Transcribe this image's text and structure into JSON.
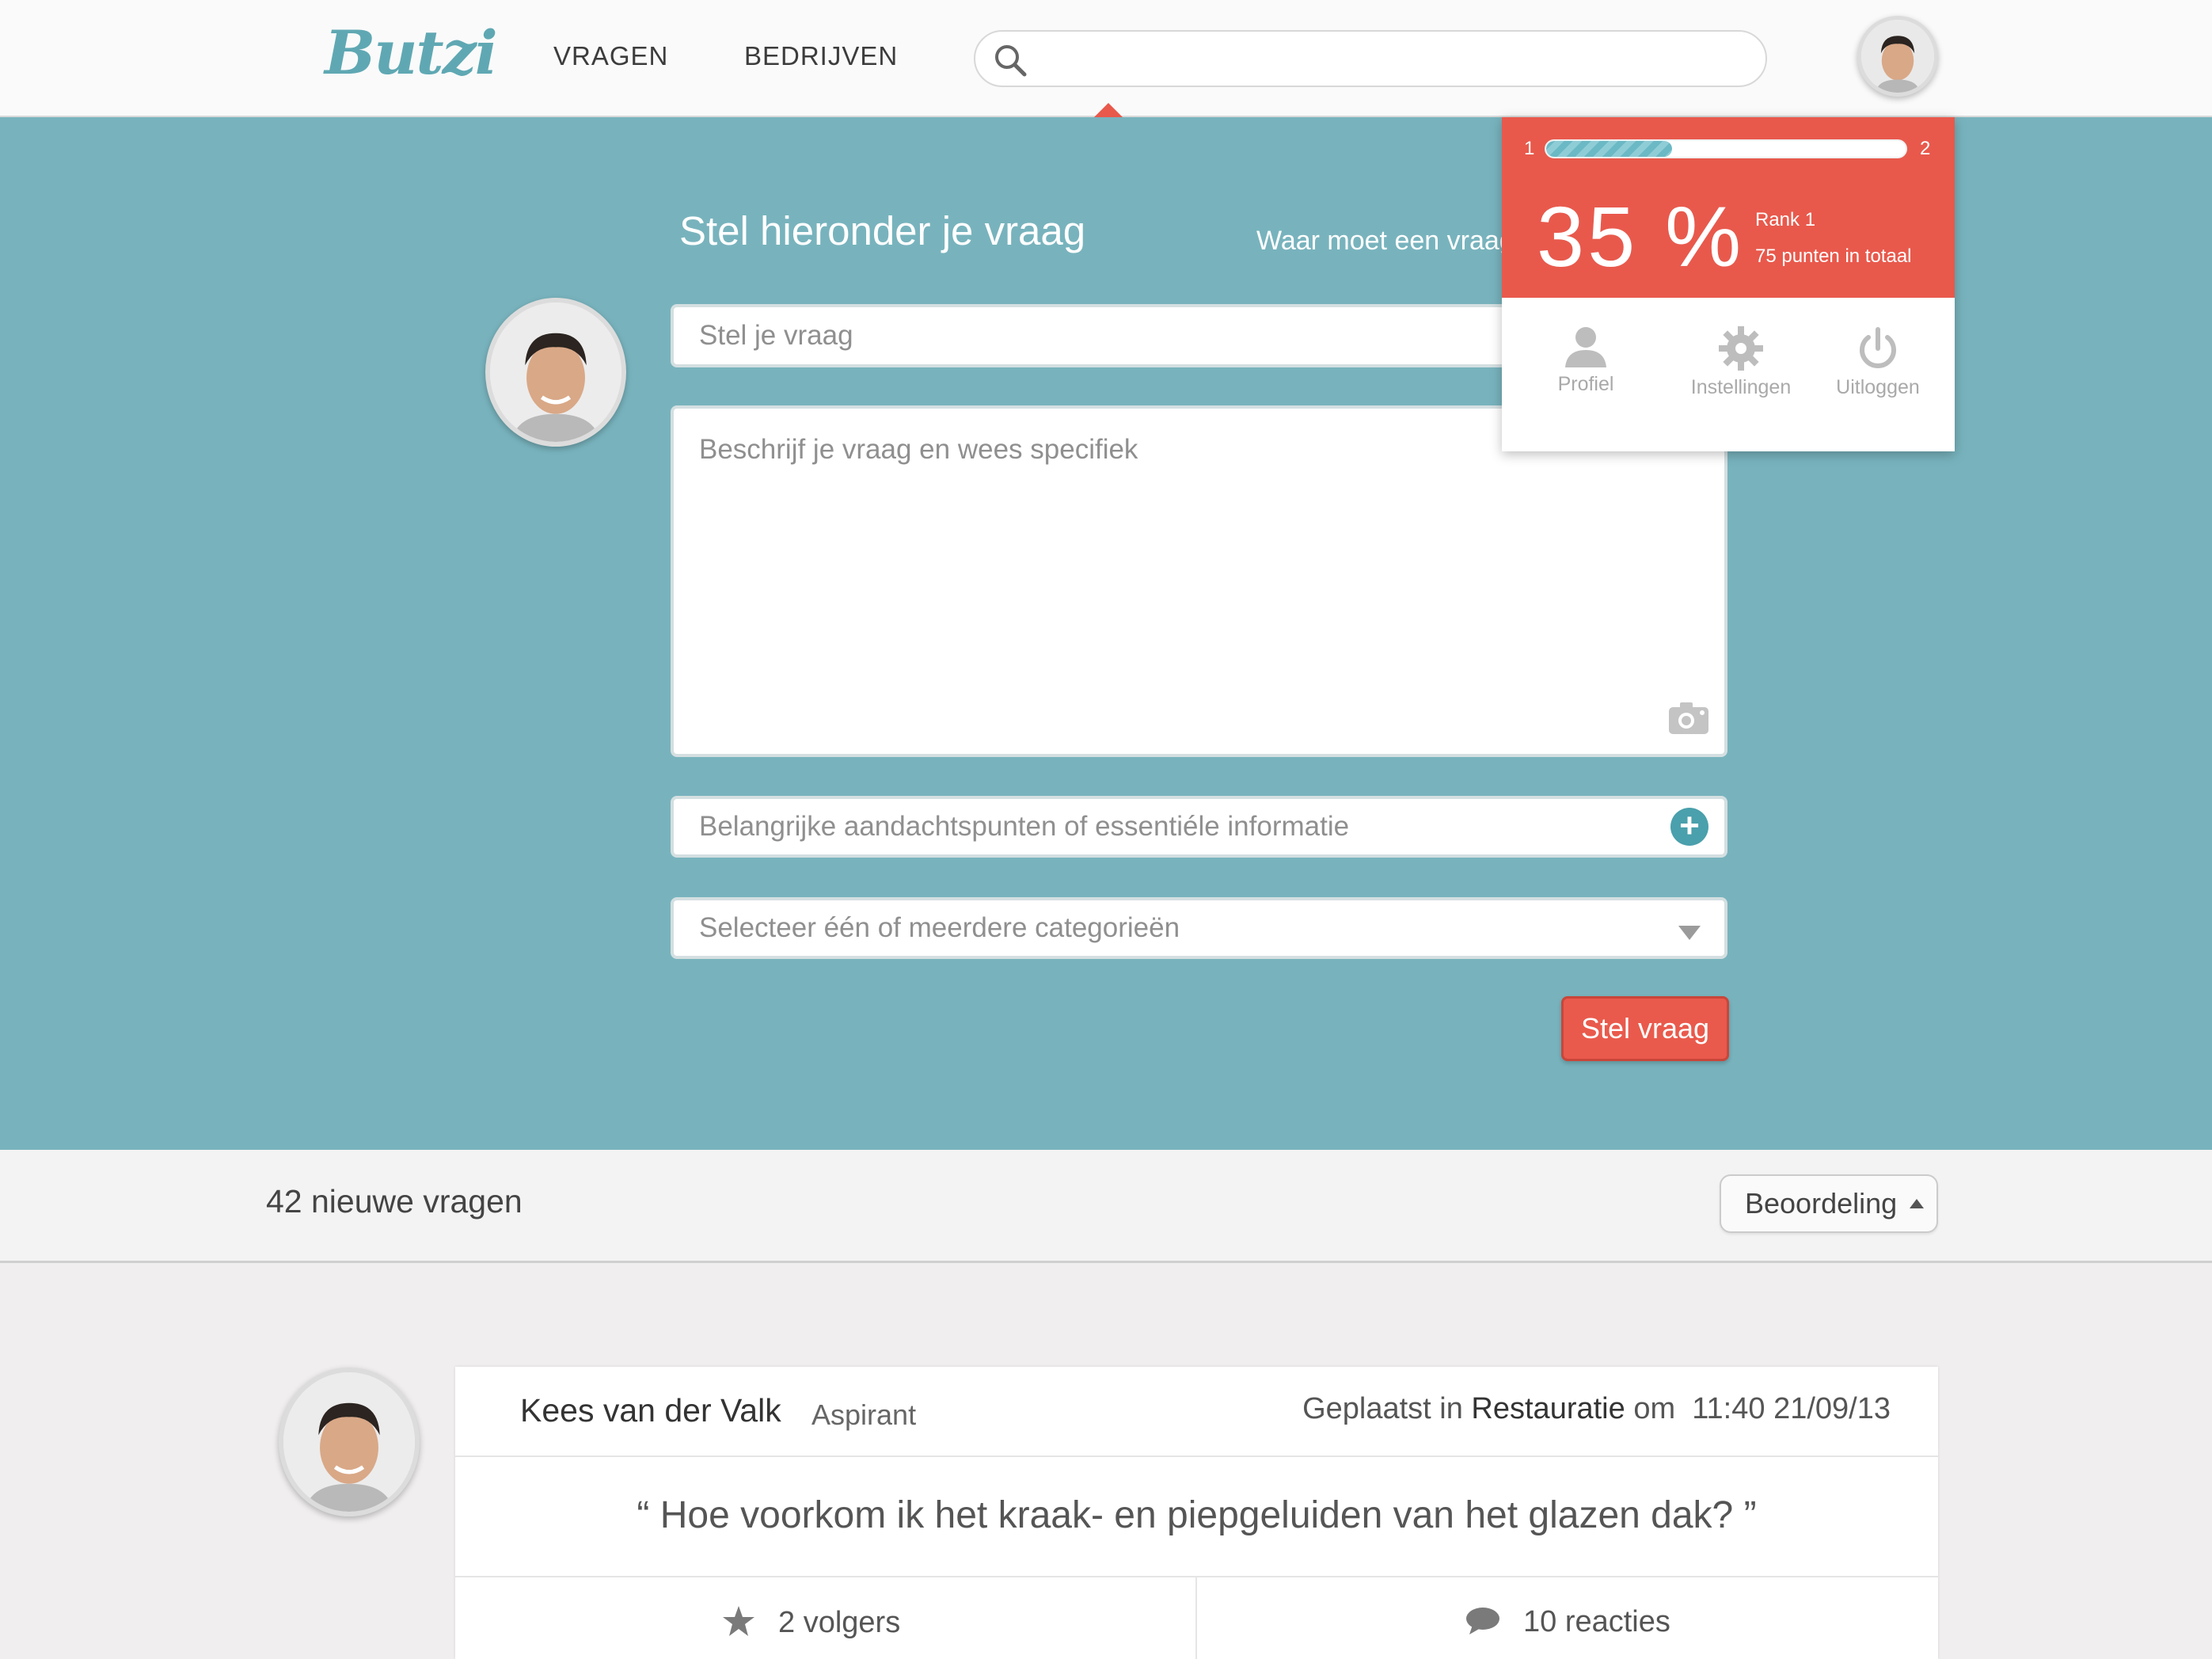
{
  "header": {
    "logo": "Butzi",
    "nav": [
      "VRAGEN",
      "BEDRIJVEN"
    ],
    "search_placeholder": ""
  },
  "ask": {
    "title": "Stel hieronder je vraag",
    "help_link": "Waar moet een vraag",
    "question_placeholder": "Stel je vraag",
    "description_placeholder": "Beschrijf je vraag en wees specifiek",
    "points_placeholder": "Belangrijke aandachtspunten of essentiéle informatie",
    "category_placeholder": "Selecteer één of meerdere categorieën",
    "submit_label": "Stel vraag"
  },
  "user_menu": {
    "level_from": "1",
    "level_to": "2",
    "progress_percent": 35,
    "percent_label": "35 %",
    "rank": "Rank 1",
    "points": "75 punten in totaal",
    "items": [
      {
        "label": "Profiel",
        "icon": "user-icon"
      },
      {
        "label": "Instellingen",
        "icon": "gear-icon"
      },
      {
        "label": "Uitloggen",
        "icon": "power-icon"
      }
    ]
  },
  "list": {
    "count_label": "42 nieuwe vragen",
    "sort_label": "Beoordeling"
  },
  "question": {
    "author": "Kees van der Valk",
    "role": "Aspirant",
    "posted_prefix": "Geplaatst in",
    "category": "Restauratie",
    "posted_at": "om",
    "time": "11:40",
    "date": "21/09/13",
    "text": "“ Hoe voorkom ik het kraak- en piepgeluiden van het glazen dak? ”",
    "followers": "2 volgers",
    "reactions": "10 reacties"
  },
  "colors": {
    "teal": "#78b3bd",
    "accent_red": "#e8594c",
    "logo": "#5fa8b3"
  }
}
